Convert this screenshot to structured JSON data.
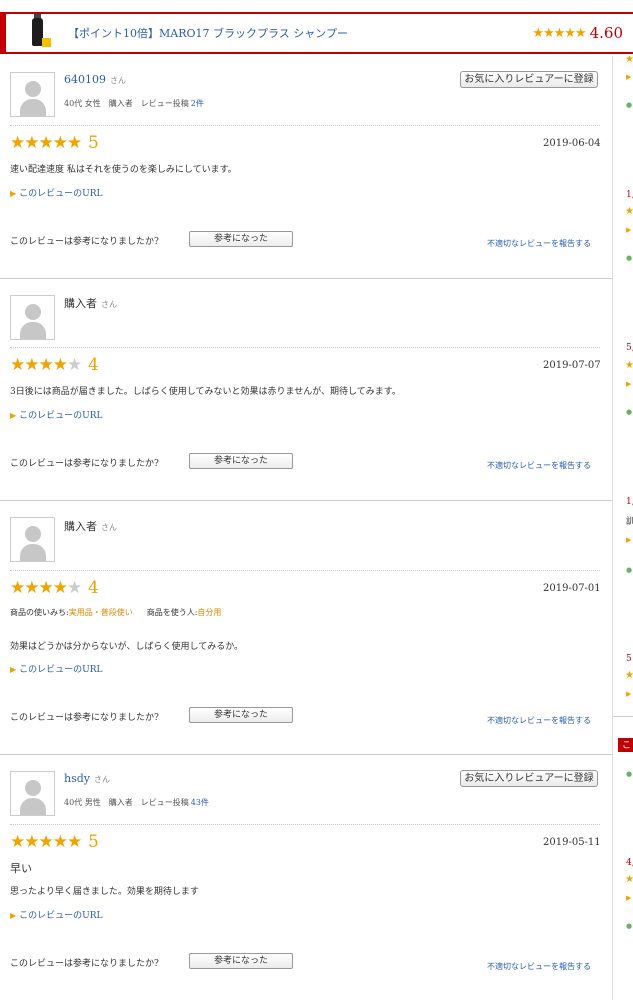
{
  "header": {
    "product_title": "【ポイント10倍】MARO17 ブラックプラス シャンプー",
    "rating_stars": "★★★★★",
    "rating_value": "4.60"
  },
  "common": {
    "san": "さん",
    "fav_button": "お気に入りレビュアーに登録",
    "url_link": "このレビューのURL",
    "url_tri": "▶",
    "helpful_question": "このレビューは参考になりましたか?",
    "helpful_button": "参考になった",
    "report_link": "不適切なレビューを報告する"
  },
  "reviews": [
    {
      "username": "640109",
      "userinfo": "40代 女性　購入者　レビュー投稿",
      "post_count": "2件",
      "stars_on": "★★★★★",
      "stars_off": "",
      "score": "5",
      "date": "2019-06-04",
      "body": "速い配達速度 私はそれを使うのを楽しみにしています。"
    },
    {
      "username": "購入者",
      "stars_on": "★★★★",
      "stars_off": "★",
      "score": "4",
      "date": "2019-07-07",
      "body": "3日後には商品が届きました。しばらく使用してみないと効果は赤りませんが、期待してみます。"
    },
    {
      "username": "購入者",
      "stars_on": "★★★★",
      "stars_off": "★",
      "score": "4",
      "date": "2019-07-01",
      "usage_label1": "商品の使いみち:",
      "usage_value1": "実用品・普段使い",
      "usage_label2": "商品を使う人:",
      "usage_value2": "自分用",
      "body": "効果はどうかは分からないが、しばらく使用してみるか。"
    },
    {
      "username": "hsdy",
      "userinfo": "40代 男性　購入者　レビュー投稿",
      "post_count": "43件",
      "stars_on": "★★★★★",
      "stars_off": "",
      "score": "5",
      "date": "2019-05-11",
      "title": "早い",
      "body": "思ったより早く届きました。効果を期待します"
    }
  ],
  "sidebar": {
    "n1": "1,",
    "n2": "5,",
    "n3": "1,",
    "t3": "訓",
    "n4": "5!",
    "red_tab": "こ",
    "n5": "4,"
  },
  "colors": {
    "accent_red": "#bf0000",
    "star_orange": "#f0a400",
    "link_blue": "#2a5db0"
  }
}
